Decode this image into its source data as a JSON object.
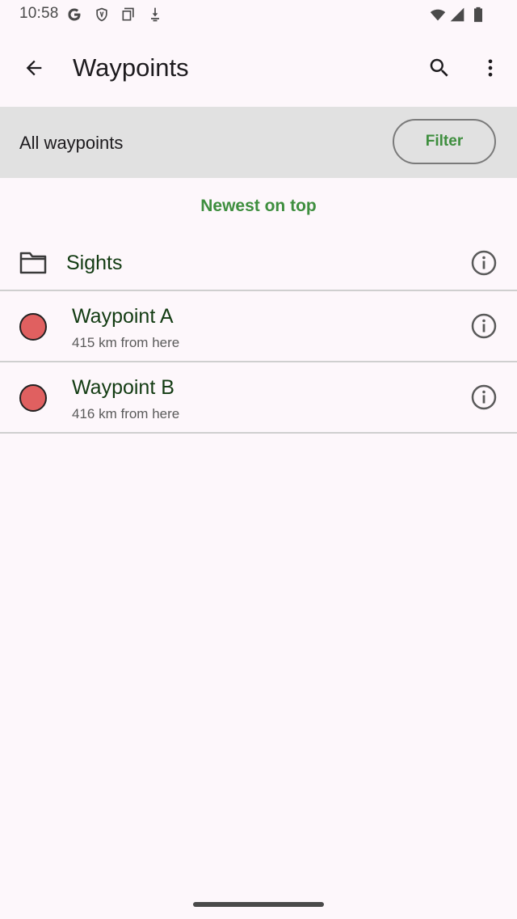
{
  "status_bar": {
    "time": "10:58",
    "icons": [
      "google-icon",
      "shield-icon",
      "screen-icon",
      "download-icon",
      "wifi-icon",
      "signal-icon",
      "battery-icon"
    ]
  },
  "app_bar": {
    "title": "Waypoints",
    "icons": [
      "arrow-back-icon",
      "search-icon",
      "more-vert-icon"
    ]
  },
  "filter_bar": {
    "label": "All waypoints",
    "button_label": "Filter"
  },
  "sort": {
    "label": "Newest on top"
  },
  "list": {
    "folder": {
      "name": "Sights"
    },
    "waypoints": [
      {
        "name": "Waypoint A",
        "distance": "415 km from here",
        "color": "#e06060"
      },
      {
        "name": "Waypoint B",
        "distance": "416 km from here",
        "color": "#e06060"
      }
    ]
  },
  "colors": {
    "accent": "#3e8e3e",
    "background": "#fdf7fb",
    "filter_bar": "#e1e1e1",
    "item_text": "#123b12"
  }
}
